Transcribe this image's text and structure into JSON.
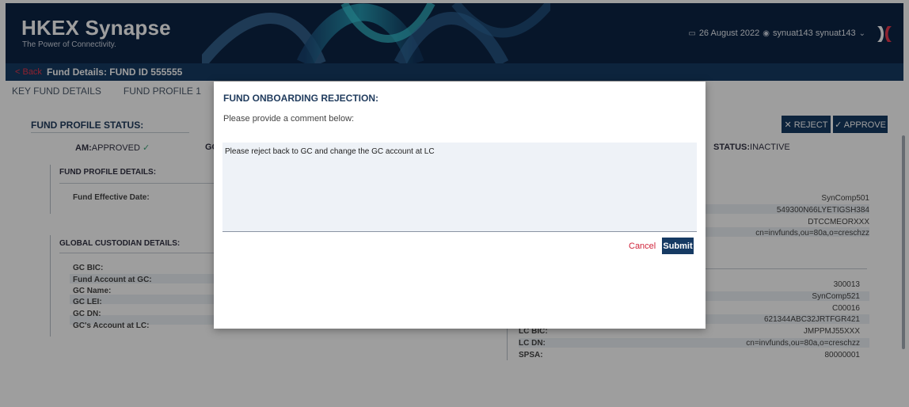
{
  "header": {
    "brand": "HKEX Synapse",
    "tagline": "The Power of Connectivity.",
    "date": "26 August 2022",
    "user": "synuat143 synuat143",
    "calendar_icon": "calendar-icon",
    "user_icon": "user-circle-icon",
    "dropdown_icon": "chevron-down-icon",
    "logo_icon": "hkex-x-logo",
    "bg_color": "#0c2445"
  },
  "subbar": {
    "back_label": "< Back",
    "title": "Fund Details: FUND ID 555555"
  },
  "tabs": [
    "KEY FUND DETAILS",
    "FUND PROFILE 1"
  ],
  "status": {
    "title": "FUND PROFILE STATUS:",
    "am_label": "AM:",
    "am_value": "APPROVED",
    "am_check": "✓",
    "gc_label": "GC",
    "right_label": "STATUS:",
    "right_value": "INACTIVE"
  },
  "actions": {
    "reject": "✕ REJECT",
    "approve": "✓ APPROVE"
  },
  "fund_profile": {
    "title": "FUND PROFILE DETAILS:",
    "effective_date_label": "Fund Effective Date:"
  },
  "global_custodian": {
    "title": "GLOBAL CUSTODIAN DETAILS:",
    "labels": [
      "GC BIC:",
      "Fund Account at GC:",
      "GC Name:",
      "GC LEI:",
      "GC DN:",
      "GC's Account at LC:"
    ]
  },
  "right_top_values": [
    "SynComp501",
    "549300N66LYETIGSH384",
    "DTCCMEORXXX",
    "cn=invfunds,ou=80a,o=creschzz"
  ],
  "right_bottom": {
    "values": [
      "300013",
      "SynComp521",
      "C00016",
      "621344ABC32JRTFGR421",
      "JMPPMJ55XXX",
      "cn=invfunds,ou=80a,o=creschzz",
      "80000001"
    ],
    "labels": [
      "LC BIC:",
      "LC DN:",
      "SPSA:"
    ]
  },
  "modal": {
    "title": "FUND ONBOARDING REJECTION:",
    "subtitle": "Please provide a comment below:",
    "comment": "Please reject back to GC and change the GC account at LC",
    "cancel": "Cancel",
    "submit": "Submit",
    "accent": "#163a63",
    "cancel_color": "#d0243b"
  }
}
